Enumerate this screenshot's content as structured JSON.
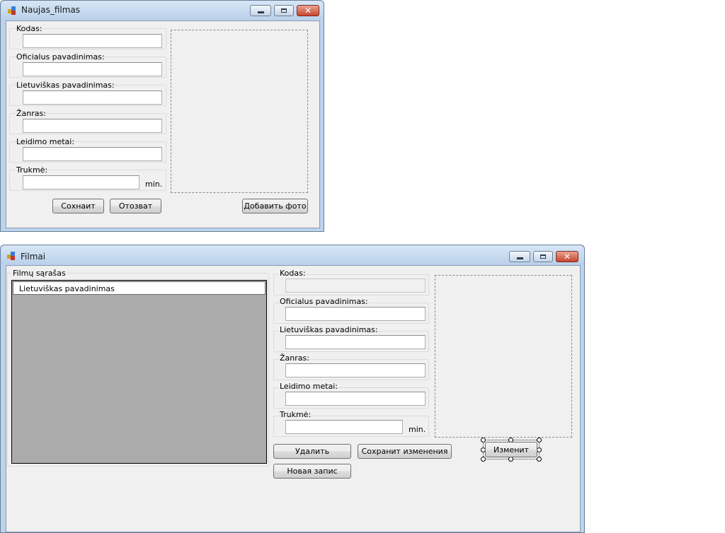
{
  "window1": {
    "title": "Naujas_filmas",
    "fields": {
      "kodas_label": "Kodas:",
      "kodas_value": "",
      "oficialus_label": "Oficialus pavadinimas:",
      "oficialus_value": "",
      "lietuviskas_label": "Lietuviškas pavadinimas:",
      "lietuviskas_value": "",
      "zanras_label": "Žanras:",
      "zanras_value": "",
      "leidimo_label": "Leidimo metai:",
      "leidimo_value": "",
      "trukme_label": "Trukmė:",
      "trukme_value": "",
      "min_label": "min."
    },
    "buttons": {
      "save": "Сохнаит",
      "cancel": "Отозват",
      "add_photo": "Добавить фото"
    }
  },
  "window2": {
    "title": "Filmai",
    "list_group_label": "Filmų sąrašas",
    "grid_header": "Lietuviškas pavadinimas",
    "fields": {
      "kodas_label": "Kodas:",
      "kodas_value": "",
      "oficialus_label": "Oficialus pavadinimas:",
      "oficialus_value": "",
      "lietuviskas_label": "Lietuviškas pavadinimas:",
      "lietuviskas_value": "",
      "zanras_label": "Žanras:",
      "zanras_value": "",
      "leidimo_label": "Leidimo metai:",
      "leidimo_value": "",
      "trukme_label": "Trukmė:",
      "trukme_value": "",
      "min_label": "min."
    },
    "buttons": {
      "delete": "Удалить",
      "save_changes": "Сохранит изменения",
      "edit": "Изменит",
      "new_record": "Новая запис"
    }
  },
  "colors": {
    "titlebar": "#c9dcf0",
    "client": "#f0f0f0",
    "grid_background": "#ababab",
    "close_button": "#c8452d"
  },
  "icons": [
    "app-icon",
    "minimize-icon",
    "maximize-icon",
    "close-icon"
  ]
}
